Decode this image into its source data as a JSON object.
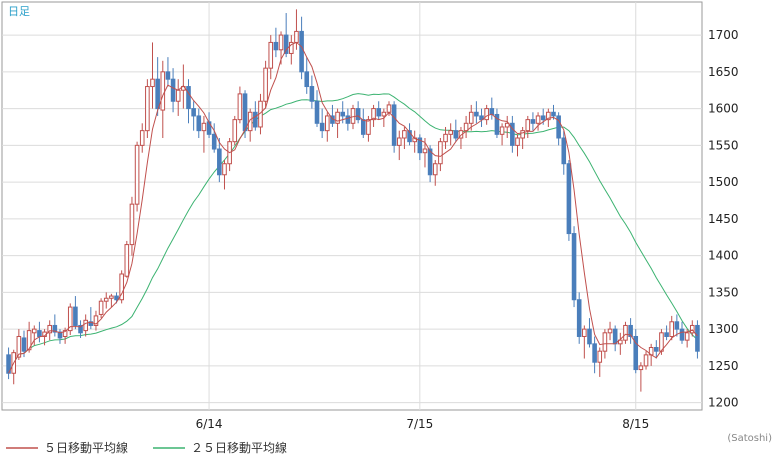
{
  "period_label": "日足",
  "credit": "(Satoshi)",
  "legend": [
    {
      "label": "５日移動平均線",
      "color": "#c0504d"
    },
    {
      "label": "２５日移動平均線",
      "color": "#3cb371"
    }
  ],
  "chart_data": {
    "type": "candlestick",
    "ylim": [
      1190,
      1745
    ],
    "y_ticks": [
      1200,
      1250,
      1300,
      1350,
      1400,
      1450,
      1500,
      1550,
      1600,
      1650,
      1700
    ],
    "x_ticks": [
      {
        "index": 39,
        "label": "6/14"
      },
      {
        "index": 80,
        "label": "7/15"
      },
      {
        "index": 122,
        "label": "8/15"
      }
    ],
    "colors": {
      "up": "#c0504d",
      "down": "#4a7ebb",
      "ma5": "#c0504d",
      "ma25": "#3cb371",
      "grid": "#dcdcdc"
    },
    "candles": [
      [
        1265,
        1275,
        1232,
        1240
      ],
      [
        1240,
        1272,
        1225,
        1268
      ],
      [
        1262,
        1300,
        1258,
        1290
      ],
      [
        1288,
        1298,
        1262,
        1270
      ],
      [
        1272,
        1310,
        1268,
        1298
      ],
      [
        1295,
        1305,
        1278,
        1300
      ],
      [
        1298,
        1310,
        1282,
        1290
      ],
      [
        1290,
        1300,
        1278,
        1296
      ],
      [
        1295,
        1312,
        1285,
        1305
      ],
      [
        1305,
        1320,
        1290,
        1296
      ],
      [
        1296,
        1300,
        1280,
        1288
      ],
      [
        1290,
        1302,
        1280,
        1298
      ],
      [
        1298,
        1335,
        1292,
        1330
      ],
      [
        1330,
        1345,
        1300,
        1305
      ],
      [
        1305,
        1312,
        1288,
        1295
      ],
      [
        1298,
        1320,
        1290,
        1312
      ],
      [
        1310,
        1330,
        1300,
        1305
      ],
      [
        1305,
        1325,
        1298,
        1318
      ],
      [
        1320,
        1342,
        1315,
        1338
      ],
      [
        1338,
        1350,
        1328,
        1342
      ],
      [
        1342,
        1348,
        1330,
        1345
      ],
      [
        1345,
        1350,
        1335,
        1340
      ],
      [
        1340,
        1380,
        1335,
        1375
      ],
      [
        1372,
        1420,
        1370,
        1415
      ],
      [
        1415,
        1480,
        1400,
        1470
      ],
      [
        1470,
        1555,
        1460,
        1550
      ],
      [
        1550,
        1580,
        1540,
        1570
      ],
      [
        1570,
        1640,
        1560,
        1630
      ],
      [
        1630,
        1690,
        1600,
        1640
      ],
      [
        1640,
        1670,
        1590,
        1600
      ],
      [
        1598,
        1665,
        1560,
        1650
      ],
      [
        1650,
        1670,
        1630,
        1640
      ],
      [
        1640,
        1655,
        1595,
        1610
      ],
      [
        1610,
        1640,
        1590,
        1625
      ],
      [
        1625,
        1660,
        1600,
        1630
      ],
      [
        1630,
        1640,
        1580,
        1600
      ],
      [
        1600,
        1610,
        1570,
        1590
      ],
      [
        1590,
        1600,
        1560,
        1570
      ],
      [
        1570,
        1590,
        1540,
        1580
      ],
      [
        1582,
        1595,
        1560,
        1565
      ],
      [
        1565,
        1580,
        1540,
        1545
      ],
      [
        1545,
        1560,
        1500,
        1510
      ],
      [
        1510,
        1530,
        1490,
        1525
      ],
      [
        1525,
        1560,
        1515,
        1555
      ],
      [
        1555,
        1590,
        1550,
        1585
      ],
      [
        1585,
        1630,
        1580,
        1620
      ],
      [
        1620,
        1625,
        1560,
        1570
      ],
      [
        1570,
        1600,
        1555,
        1595
      ],
      [
        1595,
        1610,
        1570,
        1575
      ],
      [
        1575,
        1620,
        1565,
        1610
      ],
      [
        1610,
        1665,
        1600,
        1655
      ],
      [
        1655,
        1700,
        1640,
        1690
      ],
      [
        1690,
        1710,
        1670,
        1680
      ],
      [
        1680,
        1705,
        1660,
        1700
      ],
      [
        1700,
        1730,
        1670,
        1675
      ],
      [
        1675,
        1700,
        1660,
        1690
      ],
      [
        1690,
        1735,
        1680,
        1705
      ],
      [
        1705,
        1725,
        1640,
        1650
      ],
      [
        1650,
        1670,
        1620,
        1630
      ],
      [
        1630,
        1645,
        1600,
        1610
      ],
      [
        1610,
        1625,
        1575,
        1580
      ],
      [
        1580,
        1600,
        1560,
        1570
      ],
      [
        1570,
        1595,
        1555,
        1590
      ],
      [
        1590,
        1605,
        1575,
        1580
      ],
      [
        1580,
        1600,
        1560,
        1595
      ],
      [
        1595,
        1610,
        1580,
        1590
      ],
      [
        1590,
        1600,
        1570,
        1580
      ],
      [
        1580,
        1605,
        1572,
        1600
      ],
      [
        1600,
        1610,
        1580,
        1585
      ],
      [
        1585,
        1600,
        1560,
        1565
      ],
      [
        1565,
        1590,
        1555,
        1585
      ],
      [
        1585,
        1605,
        1575,
        1600
      ],
      [
        1600,
        1610,
        1585,
        1590
      ],
      [
        1590,
        1600,
        1575,
        1595
      ],
      [
        1595,
        1610,
        1590,
        1605
      ],
      [
        1605,
        1610,
        1540,
        1550
      ],
      [
        1550,
        1570,
        1530,
        1560
      ],
      [
        1560,
        1575,
        1545,
        1570
      ],
      [
        1570,
        1580,
        1550,
        1555
      ],
      [
        1555,
        1570,
        1540,
        1560
      ],
      [
        1560,
        1565,
        1530,
        1540
      ],
      [
        1540,
        1560,
        1520,
        1545
      ],
      [
        1545,
        1550,
        1500,
        1510
      ],
      [
        1510,
        1530,
        1495,
        1525
      ],
      [
        1525,
        1560,
        1515,
        1555
      ],
      [
        1555,
        1575,
        1545,
        1565
      ],
      [
        1565,
        1580,
        1550,
        1570
      ],
      [
        1570,
        1585,
        1555,
        1560
      ],
      [
        1560,
        1575,
        1545,
        1570
      ],
      [
        1570,
        1590,
        1560,
        1580
      ],
      [
        1580,
        1605,
        1570,
        1595
      ],
      [
        1595,
        1610,
        1580,
        1590
      ],
      [
        1590,
        1600,
        1575,
        1585
      ],
      [
        1585,
        1605,
        1578,
        1600
      ],
      [
        1600,
        1615,
        1585,
        1592
      ],
      [
        1592,
        1600,
        1560,
        1565
      ],
      [
        1565,
        1580,
        1550,
        1575
      ],
      [
        1575,
        1590,
        1560,
        1580
      ],
      [
        1580,
        1590,
        1540,
        1550
      ],
      [
        1550,
        1565,
        1535,
        1560
      ],
      [
        1560,
        1575,
        1545,
        1570
      ],
      [
        1570,
        1590,
        1560,
        1585
      ],
      [
        1585,
        1595,
        1570,
        1580
      ],
      [
        1580,
        1595,
        1570,
        1590
      ],
      [
        1590,
        1600,
        1578,
        1585
      ],
      [
        1585,
        1600,
        1575,
        1595
      ],
      [
        1595,
        1605,
        1585,
        1590
      ],
      [
        1590,
        1595,
        1550,
        1560
      ],
      [
        1560,
        1570,
        1510,
        1525
      ],
      [
        1525,
        1530,
        1420,
        1430
      ],
      [
        1430,
        1440,
        1330,
        1340
      ],
      [
        1340,
        1350,
        1280,
        1290
      ],
      [
        1290,
        1305,
        1260,
        1300
      ],
      [
        1300,
        1315,
        1275,
        1280
      ],
      [
        1280,
        1290,
        1240,
        1255
      ],
      [
        1255,
        1275,
        1235,
        1270
      ],
      [
        1270,
        1300,
        1260,
        1295
      ],
      [
        1295,
        1310,
        1285,
        1300
      ],
      [
        1300,
        1305,
        1270,
        1280
      ],
      [
        1280,
        1295,
        1265,
        1285
      ],
      [
        1285,
        1310,
        1280,
        1305
      ],
      [
        1305,
        1315,
        1280,
        1290
      ],
      [
        1290,
        1300,
        1240,
        1245
      ],
      [
        1245,
        1255,
        1215,
        1250
      ],
      [
        1250,
        1270,
        1245,
        1265
      ],
      [
        1265,
        1280,
        1250,
        1275
      ],
      [
        1275,
        1285,
        1260,
        1270
      ],
      [
        1270,
        1300,
        1265,
        1295
      ],
      [
        1295,
        1305,
        1285,
        1290
      ],
      [
        1290,
        1318,
        1285,
        1310
      ],
      [
        1310,
        1320,
        1290,
        1300
      ],
      [
        1300,
        1310,
        1280,
        1285
      ],
      [
        1285,
        1300,
        1275,
        1295
      ],
      [
        1295,
        1312,
        1290,
        1305
      ],
      [
        1305,
        1312,
        1260,
        1270
      ]
    ]
  }
}
